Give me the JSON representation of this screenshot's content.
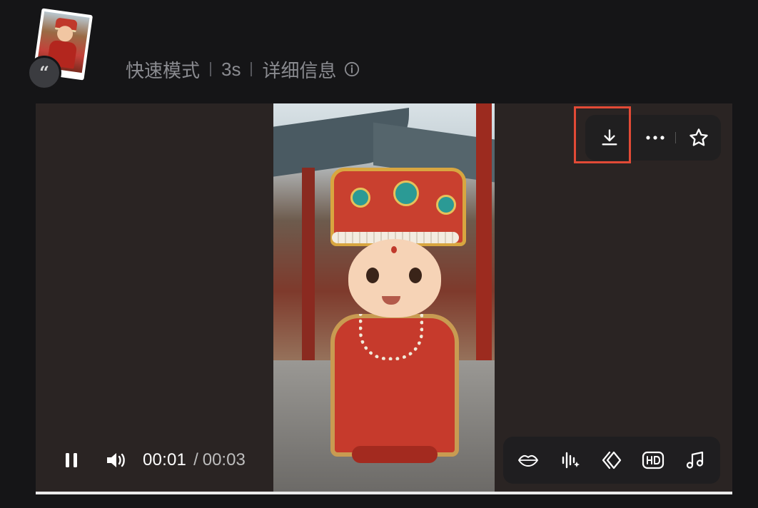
{
  "header": {
    "quote_icon": "quote-icon",
    "mode": "快速模式",
    "duration": "3s",
    "details": "详细信息"
  },
  "player": {
    "current_time": "00:01",
    "time_separator": "/",
    "total_time": "00:03",
    "progress_fraction": 1.0,
    "actions": [
      "download-icon",
      "more-icon",
      "star-icon"
    ],
    "tools": [
      "lips-icon",
      "audio-sparkle-icon",
      "frame-interpolate-icon",
      "hd-icon",
      "music-icon"
    ],
    "colors": {
      "highlight": "#e24a36",
      "background": "#151517"
    }
  }
}
